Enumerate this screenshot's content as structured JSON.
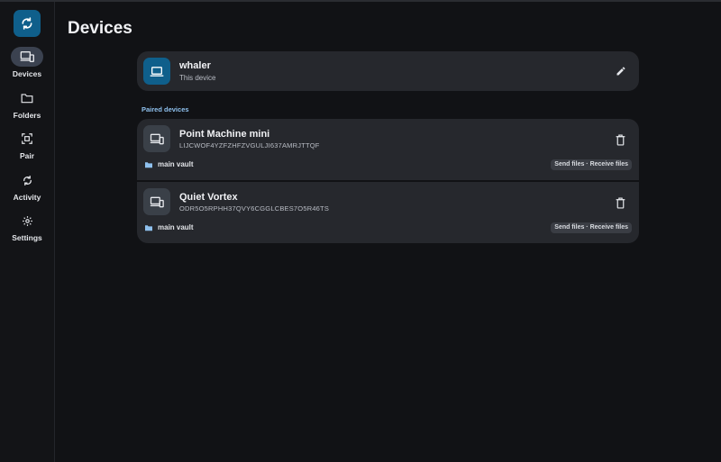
{
  "app": {
    "page_title": "Devices",
    "accent_color": "#0f5f8b",
    "logo_icon": "sync-icon"
  },
  "nav": {
    "items": [
      {
        "label": "Devices",
        "icon": "devices-icon",
        "active": true
      },
      {
        "label": "Folders",
        "icon": "folder-icon",
        "active": false
      },
      {
        "label": "Pair",
        "icon": "qr-scan-icon",
        "active": false
      },
      {
        "label": "Activity",
        "icon": "sync-icon",
        "active": false
      },
      {
        "label": "Settings",
        "icon": "gear-icon",
        "active": false
      }
    ]
  },
  "this_device": {
    "name": "whaler",
    "subtitle": "This device",
    "icon": "laptop-icon",
    "edit_icon": "pencil-icon"
  },
  "paired": {
    "section_label": "Paired devices",
    "devices": [
      {
        "name": "Point Machine mini",
        "device_id": "LIJCWOF4YZFZHFZVGULJI637AMRJTTQF",
        "folder": "main vault",
        "transfer": "Send files · Receive files",
        "icon": "devices-icon",
        "delete_icon": "trash-icon"
      },
      {
        "name": "Quiet Vortex",
        "device_id": "ODR5O5RPHH37QVY6CGGLCBES7O5R46TS",
        "folder": "main vault",
        "transfer": "Send files · Receive files",
        "icon": "devices-icon",
        "delete_icon": "trash-icon"
      }
    ]
  }
}
